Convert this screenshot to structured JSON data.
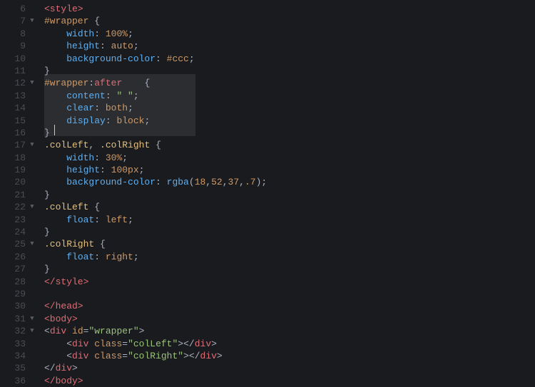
{
  "editor": {
    "firstLine": 6,
    "selection": {
      "startLine": 12,
      "endLine": 16,
      "leftPx": 6,
      "widthPx": 212
    },
    "cursor": {
      "line": 16,
      "colPx": 20
    },
    "lines": [
      {
        "n": 6,
        "fold": "",
        "tokens": [
          [
            "tag",
            "<style>"
          ]
        ]
      },
      {
        "n": 7,
        "fold": "▼",
        "tokens": [
          [
            "sel",
            "#wrapper"
          ],
          [
            "punct",
            " "
          ],
          [
            "brace",
            "{"
          ]
        ]
      },
      {
        "n": 8,
        "fold": "",
        "tokens": [
          [
            "punct",
            "    "
          ],
          [
            "prop",
            "width"
          ],
          [
            "punct",
            ": "
          ],
          [
            "num",
            "100%"
          ],
          [
            "punct",
            ";"
          ]
        ]
      },
      {
        "n": 9,
        "fold": "",
        "tokens": [
          [
            "punct",
            "    "
          ],
          [
            "prop",
            "height"
          ],
          [
            "punct",
            ": "
          ],
          [
            "val",
            "auto"
          ],
          [
            "punct",
            ";"
          ]
        ]
      },
      {
        "n": 10,
        "fold": "",
        "tokens": [
          [
            "punct",
            "    "
          ],
          [
            "prop",
            "background-color"
          ],
          [
            "punct",
            ": "
          ],
          [
            "val",
            "#ccc"
          ],
          [
            "punct",
            ";"
          ]
        ]
      },
      {
        "n": 11,
        "fold": "",
        "tokens": [
          [
            "brace",
            "}"
          ]
        ]
      },
      {
        "n": 12,
        "fold": "▼",
        "tokens": [
          [
            "sel",
            "#wrapper"
          ],
          [
            "punct",
            ":"
          ],
          [
            "pseudo",
            "after"
          ],
          [
            "punct",
            "    "
          ],
          [
            "brace",
            "{"
          ]
        ]
      },
      {
        "n": 13,
        "fold": "",
        "tokens": [
          [
            "punct",
            "    "
          ],
          [
            "prop",
            "content"
          ],
          [
            "punct",
            ": "
          ],
          [
            "str",
            "\" \""
          ],
          [
            "punct",
            ";"
          ]
        ]
      },
      {
        "n": 14,
        "fold": "",
        "tokens": [
          [
            "punct",
            "    "
          ],
          [
            "prop",
            "clear"
          ],
          [
            "punct",
            ": "
          ],
          [
            "val",
            "both"
          ],
          [
            "punct",
            ";"
          ]
        ]
      },
      {
        "n": 15,
        "fold": "",
        "tokens": [
          [
            "punct",
            "    "
          ],
          [
            "prop",
            "display"
          ],
          [
            "punct",
            ": "
          ],
          [
            "val",
            "block"
          ],
          [
            "punct",
            ";"
          ]
        ]
      },
      {
        "n": 16,
        "fold": "",
        "tokens": [
          [
            "brace",
            "}"
          ]
        ]
      },
      {
        "n": 17,
        "fold": "▼",
        "tokens": [
          [
            "selc",
            ".colLeft"
          ],
          [
            "punct",
            ", "
          ],
          [
            "selc",
            ".colRight"
          ],
          [
            "punct",
            " "
          ],
          [
            "brace",
            "{"
          ]
        ]
      },
      {
        "n": 18,
        "fold": "",
        "tokens": [
          [
            "punct",
            "    "
          ],
          [
            "prop",
            "width"
          ],
          [
            "punct",
            ": "
          ],
          [
            "num",
            "30%"
          ],
          [
            "punct",
            ";"
          ]
        ]
      },
      {
        "n": 19,
        "fold": "",
        "tokens": [
          [
            "punct",
            "    "
          ],
          [
            "prop",
            "height"
          ],
          [
            "punct",
            ": "
          ],
          [
            "num",
            "100px"
          ],
          [
            "punct",
            ";"
          ]
        ]
      },
      {
        "n": 20,
        "fold": "",
        "tokens": [
          [
            "punct",
            "    "
          ],
          [
            "prop",
            "background-color"
          ],
          [
            "punct",
            ": "
          ],
          [
            "func",
            "rgba"
          ],
          [
            "punct",
            "("
          ],
          [
            "num",
            "18"
          ],
          [
            "punct",
            ","
          ],
          [
            "num",
            "52"
          ],
          [
            "punct",
            ","
          ],
          [
            "num",
            "37"
          ],
          [
            "punct",
            ","
          ],
          [
            "num",
            ".7"
          ],
          [
            "punct",
            ");"
          ]
        ]
      },
      {
        "n": 21,
        "fold": "",
        "tokens": [
          [
            "brace",
            "}"
          ]
        ]
      },
      {
        "n": 22,
        "fold": "▼",
        "tokens": [
          [
            "selc",
            ".colLeft"
          ],
          [
            "punct",
            " "
          ],
          [
            "brace",
            "{"
          ]
        ]
      },
      {
        "n": 23,
        "fold": "",
        "tokens": [
          [
            "punct",
            "    "
          ],
          [
            "prop",
            "float"
          ],
          [
            "punct",
            ": "
          ],
          [
            "val",
            "left"
          ],
          [
            "punct",
            ";"
          ]
        ]
      },
      {
        "n": 24,
        "fold": "",
        "tokens": [
          [
            "brace",
            "}"
          ]
        ]
      },
      {
        "n": 25,
        "fold": "▼",
        "tokens": [
          [
            "selc",
            ".colRight"
          ],
          [
            "punct",
            " "
          ],
          [
            "brace",
            "{"
          ]
        ]
      },
      {
        "n": 26,
        "fold": "",
        "tokens": [
          [
            "punct",
            "    "
          ],
          [
            "prop",
            "float"
          ],
          [
            "punct",
            ": "
          ],
          [
            "val",
            "right"
          ],
          [
            "punct",
            ";"
          ]
        ]
      },
      {
        "n": 27,
        "fold": "",
        "tokens": [
          [
            "brace",
            "}"
          ]
        ]
      },
      {
        "n": 28,
        "fold": "",
        "tokens": [
          [
            "tag",
            "</style>"
          ]
        ]
      },
      {
        "n": 29,
        "fold": "",
        "tokens": []
      },
      {
        "n": 30,
        "fold": "",
        "tokens": [
          [
            "tag",
            "</head>"
          ]
        ]
      },
      {
        "n": 31,
        "fold": "▼",
        "tokens": [
          [
            "tag",
            "<body>"
          ]
        ]
      },
      {
        "n": 32,
        "fold": "▼",
        "tokens": [
          [
            "angle",
            "<"
          ],
          [
            "tag",
            "div"
          ],
          [
            "punct",
            " "
          ],
          [
            "attrn",
            "id"
          ],
          [
            "punct",
            "="
          ],
          [
            "attrv",
            "\"wrapper\""
          ],
          [
            "angle",
            ">"
          ]
        ]
      },
      {
        "n": 33,
        "fold": "",
        "tokens": [
          [
            "punct",
            "    "
          ],
          [
            "angle",
            "<"
          ],
          [
            "tag",
            "div"
          ],
          [
            "punct",
            " "
          ],
          [
            "attrn",
            "class"
          ],
          [
            "punct",
            "="
          ],
          [
            "attrv",
            "\"colLeft\""
          ],
          [
            "angle",
            ">"
          ],
          [
            "angle",
            "</"
          ],
          [
            "tag",
            "div"
          ],
          [
            "angle",
            ">"
          ]
        ]
      },
      {
        "n": 34,
        "fold": "",
        "tokens": [
          [
            "punct",
            "    "
          ],
          [
            "angle",
            "<"
          ],
          [
            "tag",
            "div"
          ],
          [
            "punct",
            " "
          ],
          [
            "attrn",
            "class"
          ],
          [
            "punct",
            "="
          ],
          [
            "attrv",
            "\"colRight\""
          ],
          [
            "angle",
            ">"
          ],
          [
            "angle",
            "</"
          ],
          [
            "tag",
            "div"
          ],
          [
            "angle",
            ">"
          ]
        ]
      },
      {
        "n": 35,
        "fold": "",
        "tokens": [
          [
            "angle",
            "</"
          ],
          [
            "tag",
            "div"
          ],
          [
            "angle",
            ">"
          ]
        ]
      },
      {
        "n": 36,
        "fold": "",
        "tokens": [
          [
            "tag",
            "</body>"
          ]
        ]
      }
    ]
  }
}
